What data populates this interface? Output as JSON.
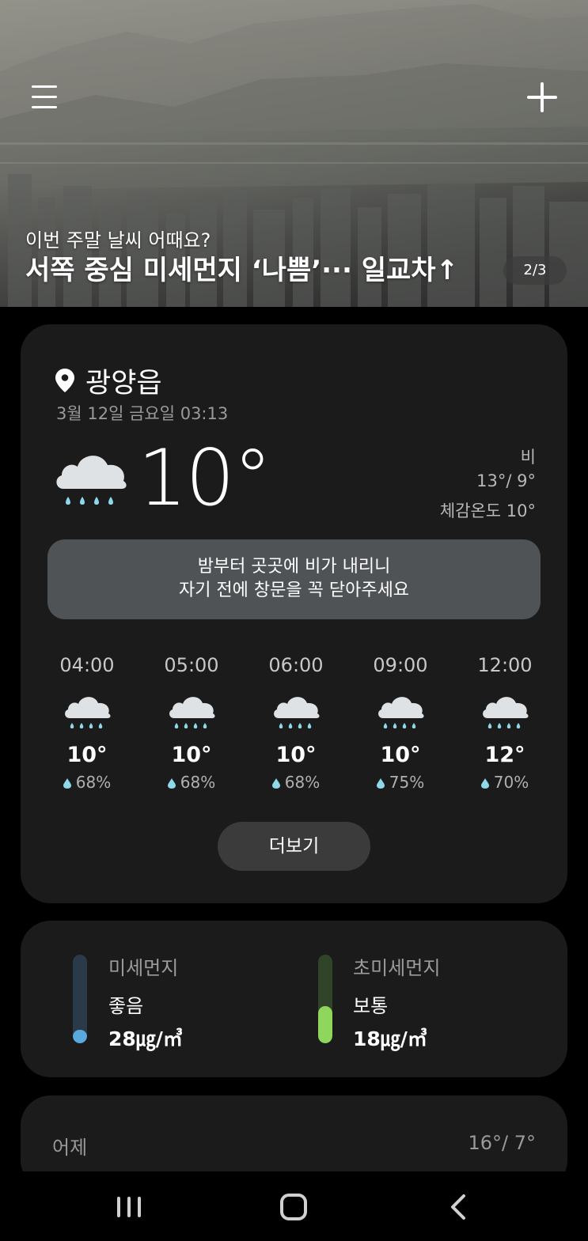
{
  "hero": {
    "subtitle": "이번 주말 날씨 어때요?",
    "headline": "서쪽 중심 미세먼지 ‘나쁨’··· 일교차↑",
    "pager": "2/3",
    "menu_icon": "menu-icon",
    "add_icon": "plus-icon"
  },
  "current": {
    "location": "광양읍",
    "datetime": "3월 12일 금요일 03:13",
    "temperature": "10°",
    "condition": "비",
    "hilo": "13°/ 9°",
    "feels_like": "체감온도 10°",
    "icon": "rain-cloud-icon",
    "notice_line1": "밤부터 곳곳에 비가 내리니",
    "notice_line2": "자기 전에 창문을 꼭 닫아주세요"
  },
  "hourly": [
    {
      "time": "04:00",
      "temp": "10°",
      "precip": "68%",
      "icon": "rain-cloud-icon"
    },
    {
      "time": "05:00",
      "temp": "10°",
      "precip": "68%",
      "icon": "rain-cloud-icon"
    },
    {
      "time": "06:00",
      "temp": "10°",
      "precip": "68%",
      "icon": "rain-cloud-icon"
    },
    {
      "time": "09:00",
      "temp": "10°",
      "precip": "75%",
      "icon": "rain-cloud-icon"
    },
    {
      "time": "12:00",
      "temp": "12°",
      "precip": "70%",
      "icon": "rain-cloud-icon"
    }
  ],
  "more_label": "더보기",
  "dust": {
    "pm10": {
      "label": "미세먼지",
      "status": "좋음",
      "value": "28㎍/㎥",
      "level": 0.15,
      "color": "#5aa9dc",
      "track": "#2a3a48"
    },
    "pm25": {
      "label": "초미세먼지",
      "status": "보통",
      "value": "18㎍/㎥",
      "level": 0.42,
      "color": "#8fd65c",
      "track": "#2f4428"
    }
  },
  "yesterday": {
    "label": "어제",
    "value": "16°/ 7°"
  },
  "colors": {
    "background": "#000000",
    "card": "#1b1b1b",
    "notice": "#505355",
    "rain_drop": "#8fd8ea"
  }
}
